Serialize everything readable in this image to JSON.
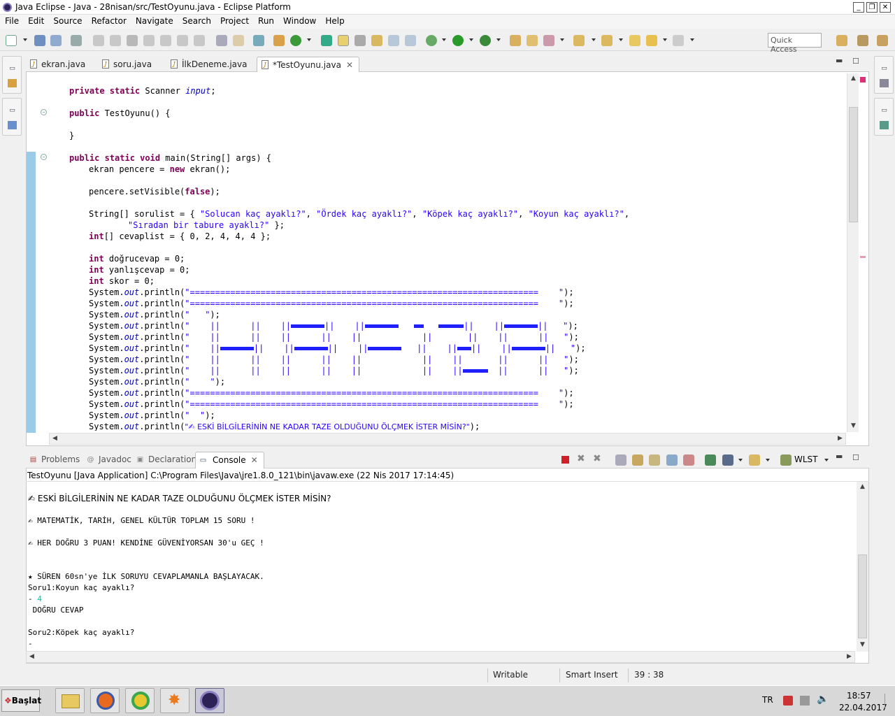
{
  "window": {
    "title": "Java Eclipse - Java - 28nisan/src/TestOyunu.java - Eclipse Platform"
  },
  "menu": [
    "File",
    "Edit",
    "Source",
    "Refactor",
    "Navigate",
    "Search",
    "Project",
    "Run",
    "Window",
    "Help"
  ],
  "toolbar": {
    "quick_access_placeholder": "Quick Access"
  },
  "editor_tabs": [
    {
      "label": "ekran.java"
    },
    {
      "label": "soru.java"
    },
    {
      "label": "İlkDeneme.java"
    },
    {
      "label": "*TestOyunu.java"
    }
  ],
  "code": {
    "l1_kw": "private static",
    "l1_rest": " Scanner ",
    "l1_fld": "input",
    "l1_end": ";",
    "l2_kw": "public",
    "l2_rest": " TestOyunu() {",
    "l3": "}",
    "l4_kw": "public static void",
    "l4_rest": " main(String[] args) {",
    "l5_a": "ekran pencere = ",
    "l5_kw": "new",
    "l5_b": " ekran();",
    "l6_a": "pencere.setVisible(",
    "l6_kw": "false",
    "l6_b": ");",
    "l7_a": "String[] sorulist = { ",
    "l7_s1": "\"Solucan kaç ayaklı?\"",
    "l7_s2": "\"Ördek kaç ayaklı?\"",
    "l7_s3": "\"Köpek kaç ayaklı?\"",
    "l7_s4": "\"Koyun kaç ayaklı?\"",
    "l8_s": "\"Sıradan bir tabure ayaklı?\"",
    "l8_b": " };",
    "l9_kw": "int",
    "l9_b": "[] cevaplist = { 0, 2, 4, 4, 4 };",
    "l10_kw": "int",
    "l10_b": " doğrucevap = 0;",
    "l11_kw": "int",
    "l11_b": " yanlışcevap = 0;",
    "l12_kw": "int",
    "l12_b": " skor = 0;",
    "sys": "System.",
    "out": "out",
    "println": ".println(",
    "eqline": "\"=====================================================================    \"",
    "blank1": "\"   \"",
    "blank2": "\"    \"",
    "blank3": "\"  \"",
    "last_str": "\"✍ ESKİ BİLGİLERİNİN NE KADAR TAZE OLDUĞUNU ÖLÇMEK İSTER MİSİN?\"",
    "close": ");"
  },
  "console_tabs": [
    {
      "label": "Problems"
    },
    {
      "label": "Javadoc"
    },
    {
      "label": "Declaration"
    },
    {
      "label": "Console"
    }
  ],
  "console_toolbar": {
    "wlst": "WLST"
  },
  "console": {
    "description": "TestOyunu [Java Application] C:\\Program Files\\Java\\jre1.8.0_121\\bin\\javaw.exe (22 Nis 2017 17:14:45)",
    "lines": [
      "✍ ESKİ BİLGİLERİNİN NE KADAR TAZE OLDUĞUNU ÖLÇMEK İSTER MİSİN?",
      "✍ MATEMATİK, TARİH, GENEL KÜLTÜR TOPLAM 15 SORU !",
      "✍ HER DOĞRU 3 PUAN! KENDİNE GÜVENİYORSAN 30'u GEÇ !",
      "★ SÜREN 60sn'ye İLK SORUYU CEVAPLAMANLA BAŞLAYACAK.",
      "Soru1:Koyun kaç ayaklı?",
      "- ",
      "4",
      " DOĞRU CEVAP",
      "Soru2:Köpek kaç ayaklı?",
      "-"
    ]
  },
  "status": {
    "writable": "Writable",
    "insert": "Smart Insert",
    "position": "39 : 38"
  },
  "taskbar": {
    "start": "Başlat",
    "lang": "TR",
    "time": "18:57",
    "date": "22.04.2017"
  },
  "colors": {
    "keyword": "#7f0055",
    "string": "#2a00ff",
    "field": "#0000c0",
    "input_echo": "#00c8a0",
    "block": "#2020ff"
  }
}
